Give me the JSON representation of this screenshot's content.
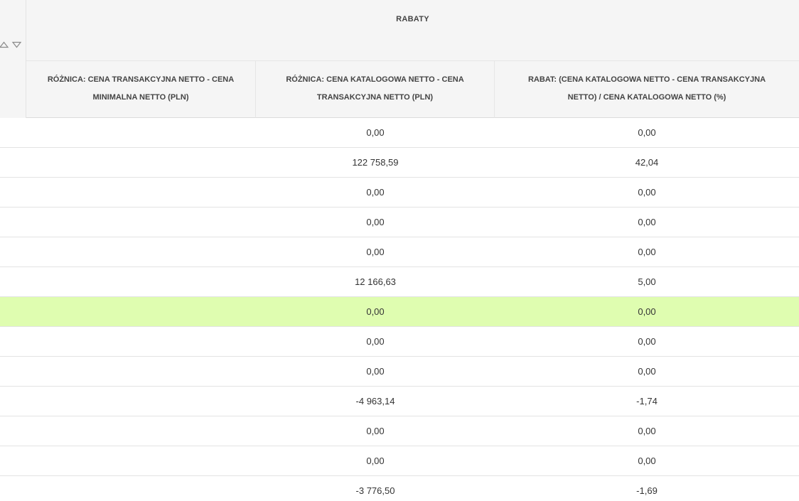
{
  "table": {
    "group_title": "RABATY",
    "columns": [
      {
        "line1": "RÓŻNICA: CENA TRANSAKCYJNA NETTO - CENA",
        "line2": "MINIMALNA NETTO (PLN)"
      },
      {
        "line1": "RÓŻNICA: CENA KATALOGOWA NETTO - CENA",
        "line2": "TRANSAKCYJNA NETTO (PLN)"
      },
      {
        "line1": "RABAT: (CENA KATALOGOWA NETTO - CENA TRANSAKCYJNA",
        "line2": "NETTO) / CENA KATALOGOWA NETTO (%)"
      }
    ],
    "rows": [
      {
        "c1": "",
        "c2": "0,00",
        "c3": "0,00"
      },
      {
        "c1": "",
        "c2": "122 758,59",
        "c3": "42,04"
      },
      {
        "c1": "",
        "c2": "0,00",
        "c3": "0,00"
      },
      {
        "c1": "",
        "c2": "0,00",
        "c3": "0,00"
      },
      {
        "c1": "",
        "c2": "0,00",
        "c3": "0,00"
      },
      {
        "c1": "",
        "c2": "12 166,63",
        "c3": "5,00"
      },
      {
        "c1": "",
        "c2": "0,00",
        "c3": "0,00",
        "highlighted": true
      },
      {
        "c1": "",
        "c2": "0,00",
        "c3": "0,00"
      },
      {
        "c1": "",
        "c2": "0,00",
        "c3": "0,00"
      },
      {
        "c1": "",
        "c2": "-4 963,14",
        "c3": "-1,74"
      },
      {
        "c1": "",
        "c2": "0,00",
        "c3": "0,00"
      },
      {
        "c1": "",
        "c2": "0,00",
        "c3": "0,00"
      },
      {
        "c1": "",
        "c2": "-3 776,50",
        "c3": "-1,69"
      }
    ],
    "highlight_color": "#dffdb0",
    "header_background": "#f5f5f5",
    "sort_icons": [
      "sort-ascending-icon",
      "sort-descending-icon"
    ]
  }
}
